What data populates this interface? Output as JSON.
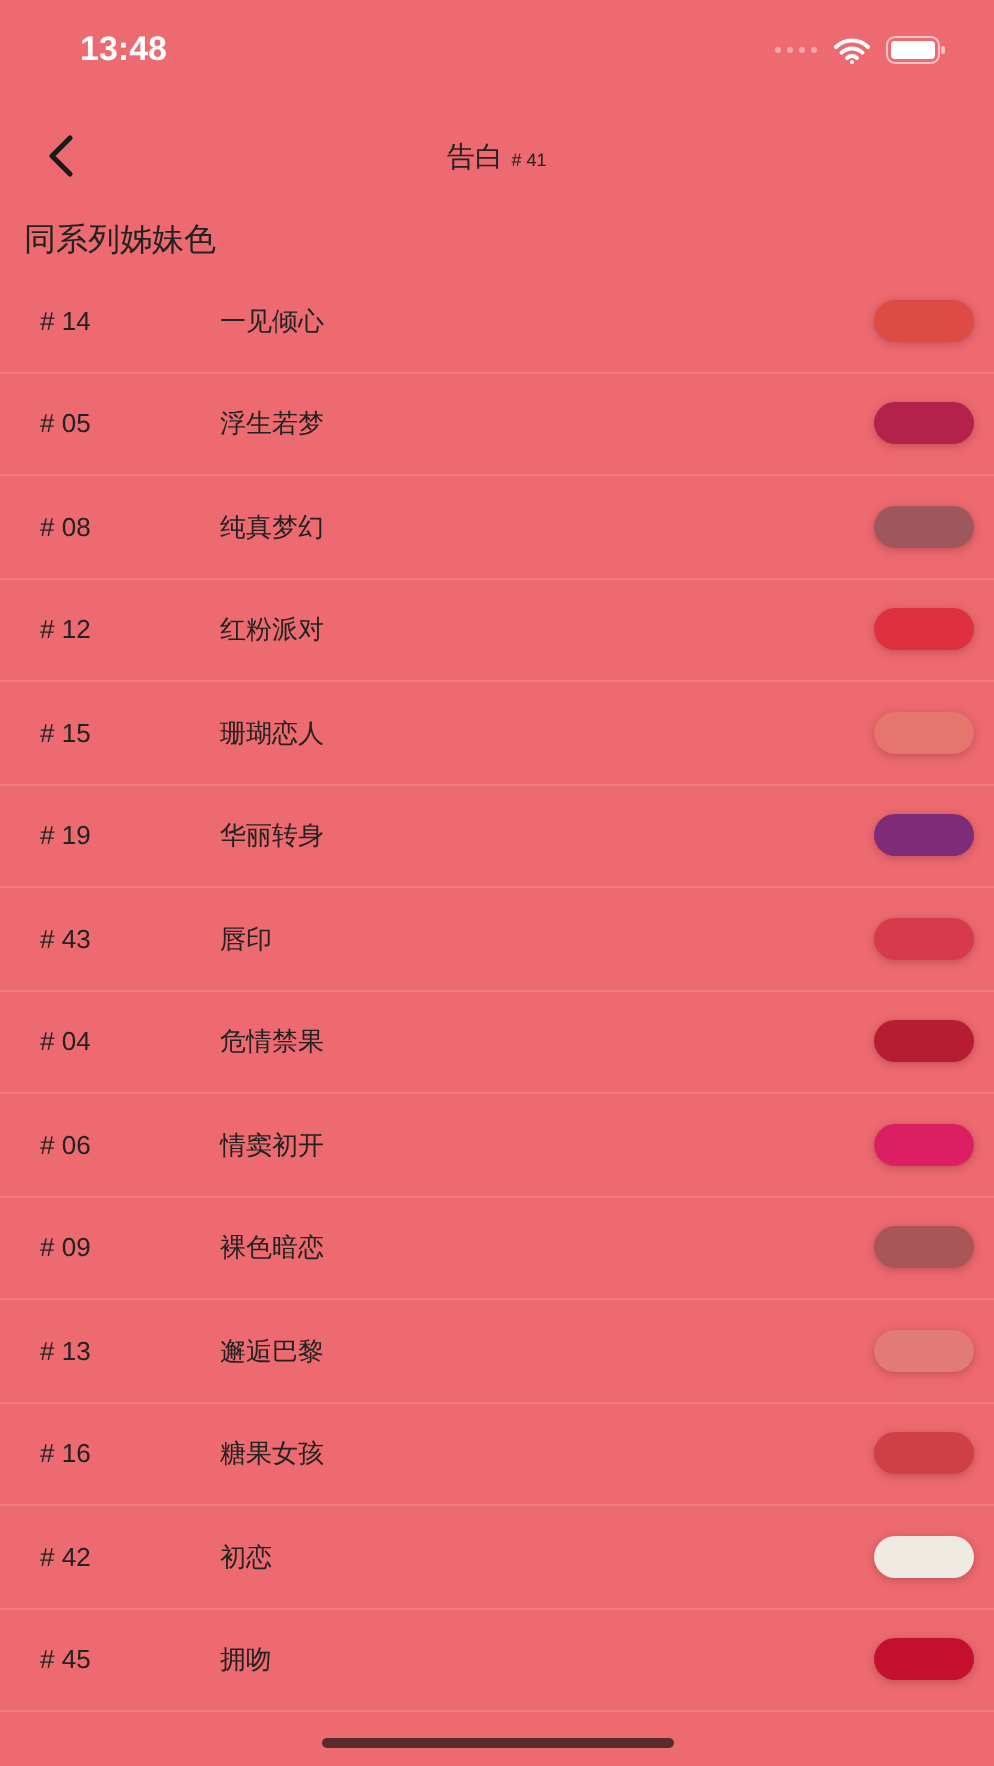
{
  "status_bar": {
    "time": "13:48"
  },
  "nav": {
    "title": "告白",
    "number": "# 41"
  },
  "section_title": "同系列姊妹色",
  "colors": [
    {
      "number": "# 14",
      "name": "一见倾心",
      "color": "#de4b45"
    },
    {
      "number": "# 05",
      "name": "浮生若梦",
      "color": "#b4214a"
    },
    {
      "number": "# 08",
      "name": "纯真梦幻",
      "color": "#9e575c"
    },
    {
      "number": "# 12",
      "name": "红粉派对",
      "color": "#e0303f"
    },
    {
      "number": "# 15",
      "name": "珊瑚恋人",
      "color": "#e6756d"
    },
    {
      "number": "# 19",
      "name": "华丽转身",
      "color": "#7e2b78"
    },
    {
      "number": "# 43",
      "name": "唇印",
      "color": "#d63a4c"
    },
    {
      "number": "# 04",
      "name": "危情禁果",
      "color": "#b61c32"
    },
    {
      "number": "# 06",
      "name": "情窦初开",
      "color": "#dc1f62"
    },
    {
      "number": "# 09",
      "name": "裸色暗恋",
      "color": "#a85658"
    },
    {
      "number": "# 13",
      "name": "邂逅巴黎",
      "color": "#e17a79"
    },
    {
      "number": "# 16",
      "name": "糖果女孩",
      "color": "#d03f45"
    },
    {
      "number": "# 42",
      "name": "初恋",
      "color": "#efebe3"
    },
    {
      "number": "# 45",
      "name": "拥吻",
      "color": "#c4102e"
    }
  ]
}
